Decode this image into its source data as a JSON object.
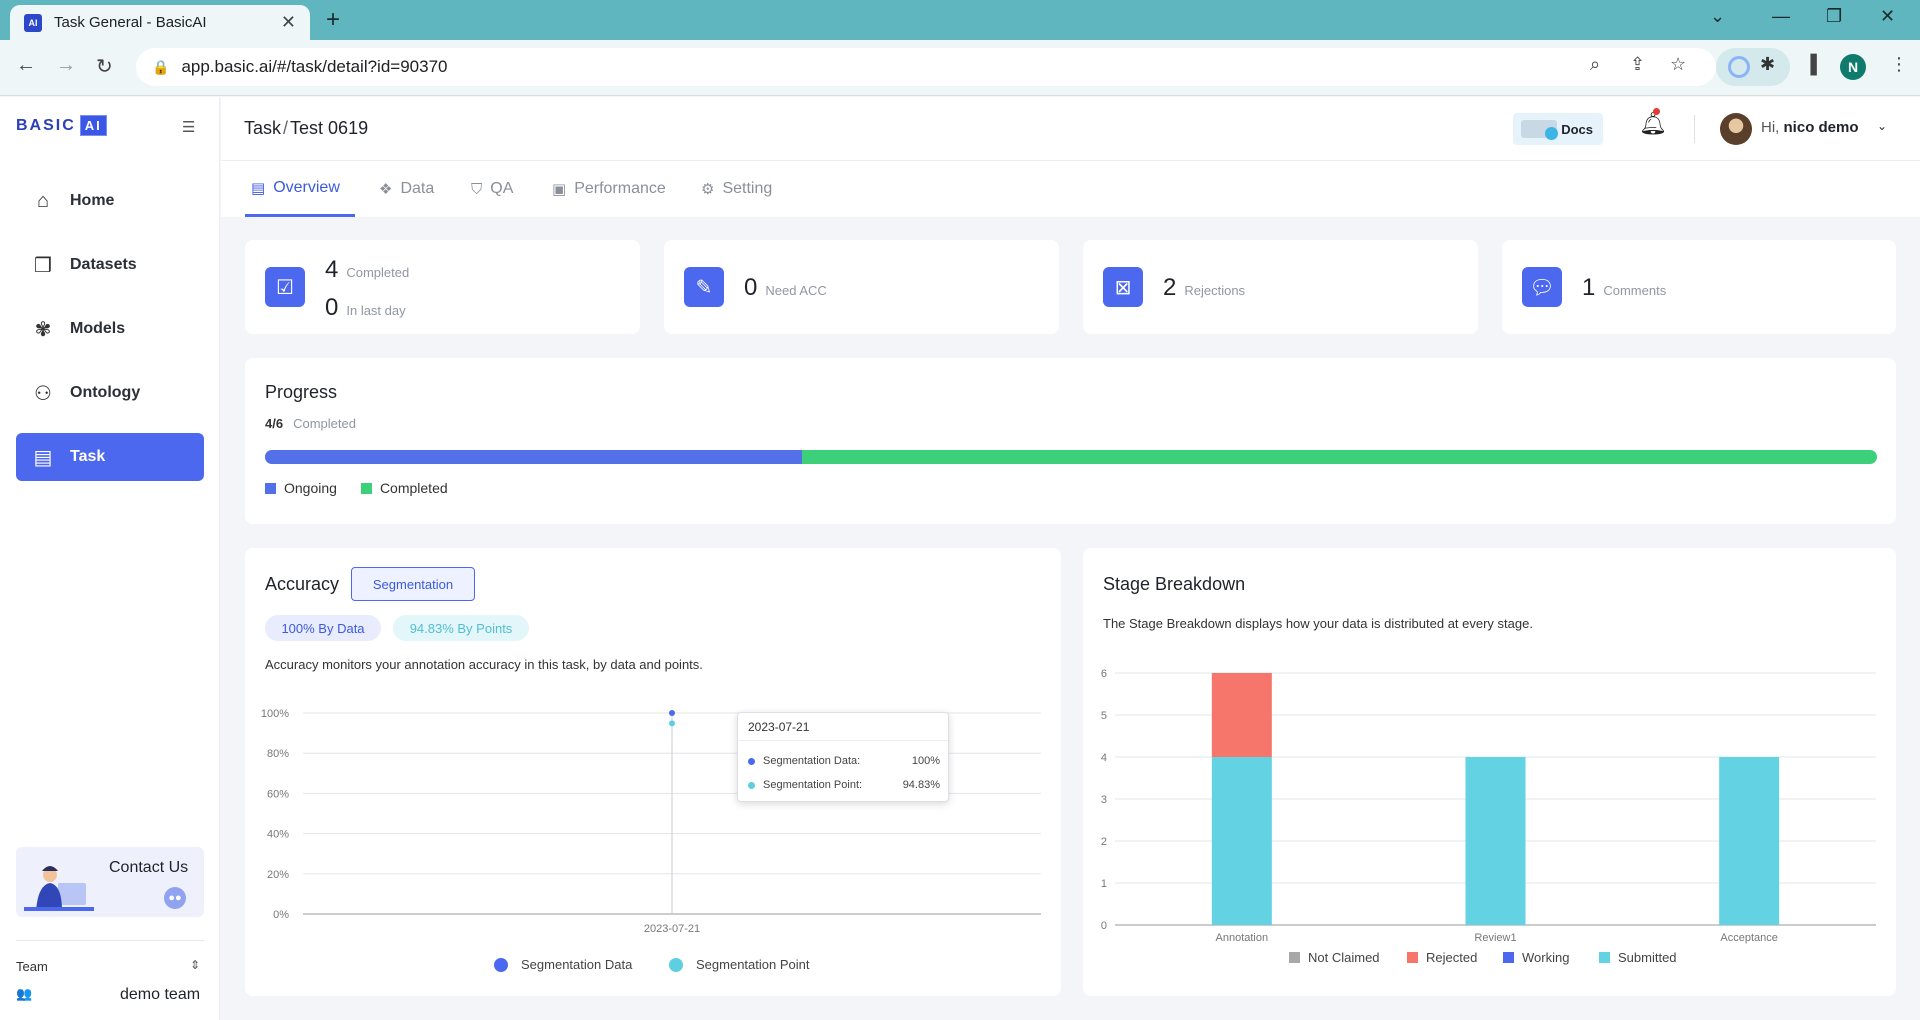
{
  "browser": {
    "tab_title": "Task General - BasicAI",
    "favicon_text": "AI",
    "url": "app.basic.ai/#/task/detail?id=90370",
    "profile_initial": "N"
  },
  "sidebar": {
    "logo_text": "BASIC",
    "logo_ai": "AI",
    "items": [
      {
        "label": "Home",
        "icon": "home-icon"
      },
      {
        "label": "Datasets",
        "icon": "datasets-icon"
      },
      {
        "label": "Models",
        "icon": "models-icon"
      },
      {
        "label": "Ontology",
        "icon": "ontology-icon"
      },
      {
        "label": "Task",
        "icon": "task-icon",
        "active": true
      }
    ],
    "contact_label": "Contact Us",
    "team_label": "Team",
    "team_name": "demo team"
  },
  "header": {
    "breadcrumb_root": "Task",
    "breadcrumb_sep": "/",
    "breadcrumb_current": "Test 0619",
    "docs_label": "Docs",
    "greeting_prefix": "Hi,",
    "user_name": "nico demo"
  },
  "tabs": [
    {
      "label": "Overview",
      "active": true
    },
    {
      "label": "Data"
    },
    {
      "label": "QA"
    },
    {
      "label": "Performance"
    },
    {
      "label": "Setting"
    }
  ],
  "stats": {
    "completed": {
      "value": "4",
      "label": "Completed"
    },
    "in_last_day": {
      "value": "0",
      "label": "In last day"
    },
    "need_acc": {
      "value": "0",
      "label": "Need ACC"
    },
    "rejections": {
      "value": "2",
      "label": "Rejections"
    },
    "comments": {
      "value": "1",
      "label": "Comments"
    }
  },
  "progress": {
    "title": "Progress",
    "count": "4/6",
    "count_label": "Completed",
    "ongoing_fraction": 0.333,
    "legend": [
      "Ongoing",
      "Completed"
    ],
    "colors": {
      "ongoing": "#5470e8",
      "completed": "#3dd07b"
    }
  },
  "accuracy": {
    "title": "Accuracy",
    "tab_label": "Segmentation",
    "by_data": "100% By Data",
    "by_points": "94.83% By Points",
    "description": "Accuracy monitors your annotation accuracy in this task, by data and points.",
    "tooltip": {
      "date": "2023-07-21",
      "rows": [
        {
          "name": "Segmentation Data:",
          "value": "100%"
        },
        {
          "name": "Segmentation Point:",
          "value": "94.83%"
        }
      ]
    }
  },
  "stage": {
    "title": "Stage Breakdown",
    "description": "The Stage Breakdown displays how your data is distributed at every stage."
  },
  "chart_data": [
    {
      "type": "line",
      "x": [
        "2023-07-21"
      ],
      "series": [
        {
          "name": "Segmentation Data",
          "values": [
            100
          ],
          "color": "#4c68ef"
        },
        {
          "name": "Segmentation Point",
          "values": [
            94.83
          ],
          "color": "#5ecfe0"
        }
      ],
      "y_ticks": [
        "0%",
        "20%",
        "40%",
        "60%",
        "80%",
        "100%"
      ],
      "ylim": [
        0,
        100
      ],
      "grid": true,
      "legend": "bottom"
    },
    {
      "type": "bar",
      "stacked": true,
      "categories": [
        "Annotation",
        "Review1",
        "Acceptance"
      ],
      "series": [
        {
          "name": "Not Claimed",
          "values": [
            0,
            0,
            0
          ],
          "color": "#a8a8a8"
        },
        {
          "name": "Rejected",
          "values": [
            2,
            0,
            0
          ],
          "color": "#f7766b"
        },
        {
          "name": "Working",
          "values": [
            0,
            0,
            0
          ],
          "color": "#4c68ef"
        },
        {
          "name": "Submitted",
          "values": [
            4,
            4,
            4
          ],
          "color": "#63d3e3"
        }
      ],
      "y_ticks": [
        "0",
        "1",
        "2",
        "3",
        "4",
        "5",
        "6"
      ],
      "ylim": [
        0,
        6
      ],
      "grid": true,
      "legend": "bottom"
    }
  ]
}
